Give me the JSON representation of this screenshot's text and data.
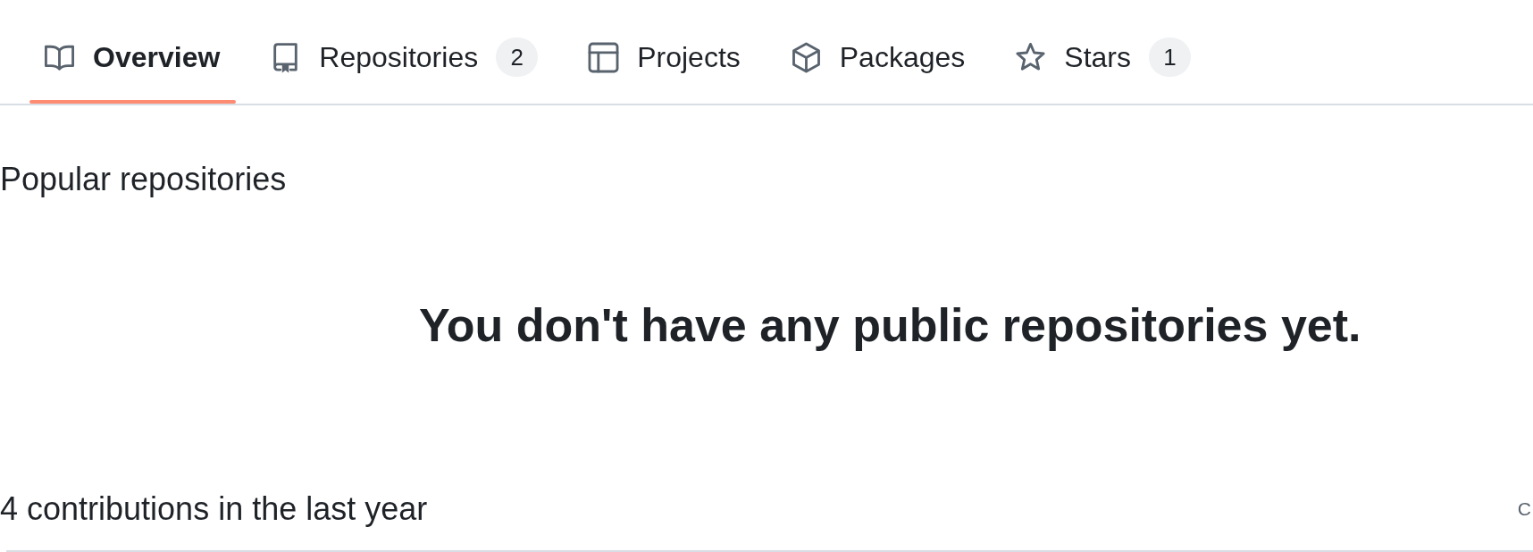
{
  "profile_tabs": [
    {
      "kind": "overview",
      "label": "Overview",
      "selected": true
    },
    {
      "kind": "repositories",
      "label": "Repositories",
      "count": "2",
      "selected": false
    },
    {
      "kind": "projects",
      "label": "Projects",
      "selected": false
    },
    {
      "kind": "packages",
      "label": "Packages",
      "selected": false
    },
    {
      "kind": "stars",
      "label": "Stars",
      "count": "1",
      "selected": false
    }
  ],
  "popular_repositories": {
    "title": "Popular repositories",
    "empty_message": "You don't have any public repositories yet."
  },
  "contributions": {
    "title": "4 contributions in the last year",
    "right_text": "C"
  }
}
